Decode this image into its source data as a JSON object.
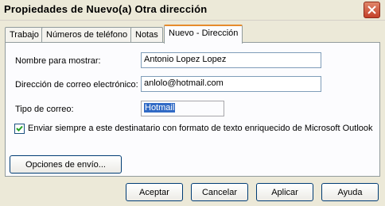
{
  "window": {
    "title": "Propiedades de Nuevo(a) Otra dirección",
    "close_icon": "close-icon"
  },
  "tabs": [
    {
      "label": "Trabajo",
      "active": false
    },
    {
      "label": "Números de teléfono",
      "active": false
    },
    {
      "label": "Notas",
      "active": false
    },
    {
      "label": "Nuevo - Dirección",
      "active": true
    }
  ],
  "form": {
    "display_name_label": "Nombre para mostrar:",
    "display_name_value": "Antonio Lopez Lopez",
    "email_label": "Dirección de correo electrónico:",
    "email_value": "anlolo@hotmail.com",
    "mail_type_label": "Tipo de correo:",
    "mail_type_value": "Hotmail",
    "rich_text_checkbox_label": "Enviar siempre a este destinatario con formato de texto enriquecido de Microsoft Outlook",
    "rich_text_checked": true,
    "send_options_button": "Opciones de envío..."
  },
  "buttons": {
    "ok": "Aceptar",
    "cancel": "Cancelar",
    "apply": "Aplicar",
    "help": "Ayuda"
  },
  "colors": {
    "dialog_bg": "#ece9d8",
    "close_button": "#c4402a",
    "active_tab_accent": "#e68b2c",
    "selection": "#316ac5"
  }
}
